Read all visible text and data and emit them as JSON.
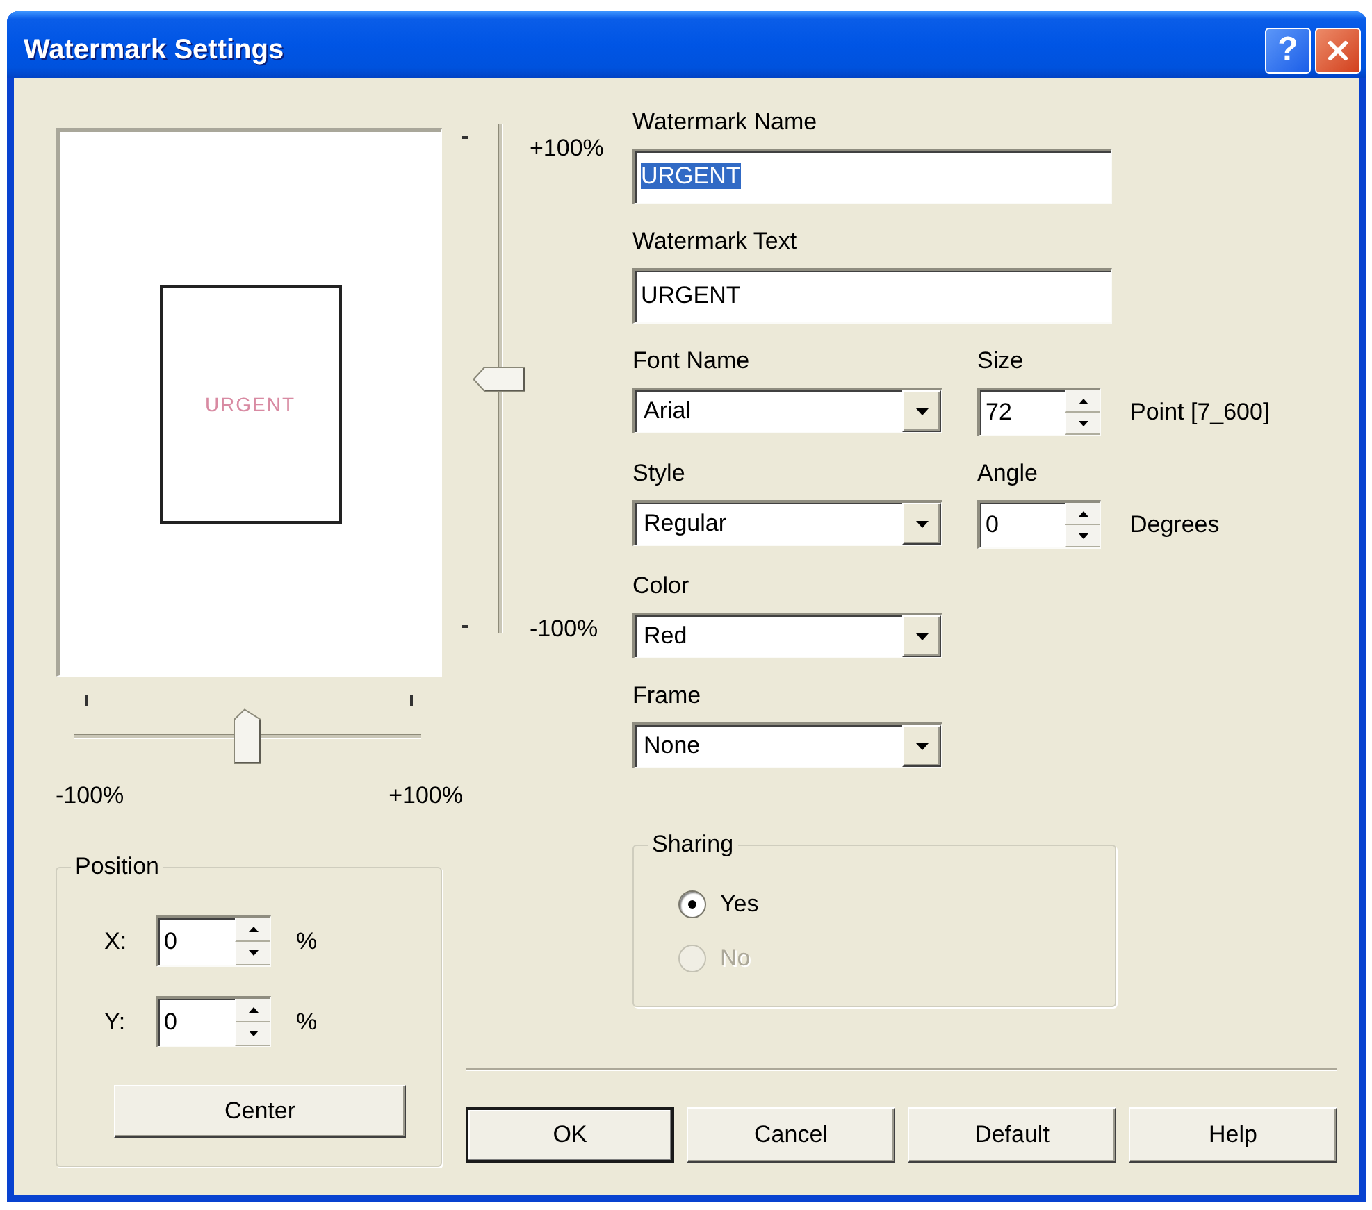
{
  "window": {
    "title": "Watermark Settings",
    "help_button": "?"
  },
  "preview": {
    "text": "URGENT"
  },
  "vertical_slider": {
    "top_label": "+100%",
    "bottom_label": "-100%",
    "level": 0.5
  },
  "horizontal_slider": {
    "left_label": "-100%",
    "right_label": "+100%",
    "level": 0.5
  },
  "form": {
    "rows": [
      {
        "items": [
          {
            "kind": "text",
            "label": "Watermark Name",
            "value": "URGENT",
            "text_highlighted": true
          }
        ]
      },
      {
        "items": [
          {
            "kind": "text",
            "label": "Watermark Text",
            "value": "URGENT",
            "text_highlighted": false
          }
        ]
      },
      {
        "items": [
          {
            "kind": "dropdown",
            "label": "Font Name",
            "value": "Arial"
          },
          {
            "kind": "spin",
            "label": "Size",
            "value": "72",
            "unit": "Point [7_600]"
          }
        ]
      },
      {
        "items": [
          {
            "kind": "dropdown",
            "label": "Style",
            "value": "Regular"
          },
          {
            "kind": "spin",
            "label": "Angle",
            "value": "0",
            "unit": "Degrees"
          }
        ]
      },
      {
        "items": [
          {
            "kind": "dropdown",
            "label": "Color",
            "value": "Red"
          }
        ]
      },
      {
        "items": [
          {
            "kind": "dropdown",
            "label": "Frame",
            "value": "None"
          }
        ]
      }
    ]
  },
  "position": {
    "title": "Position",
    "fields": [
      {
        "label": "X:",
        "value": "0",
        "unit": "%"
      },
      {
        "label": "Y:",
        "value": "0",
        "unit": "%"
      }
    ],
    "center_button": {
      "label": "Center"
    }
  },
  "sharing": {
    "title": "Sharing",
    "options": [
      {
        "label": "Yes",
        "selected": true,
        "disabled": false
      },
      {
        "label": "No",
        "selected": false,
        "disabled": true
      }
    ]
  },
  "buttons": [
    {
      "label": "OK",
      "default": true
    },
    {
      "label": "Cancel",
      "default": false
    },
    {
      "label": "Default",
      "default": false
    },
    {
      "label": "Help",
      "default": false
    }
  ]
}
